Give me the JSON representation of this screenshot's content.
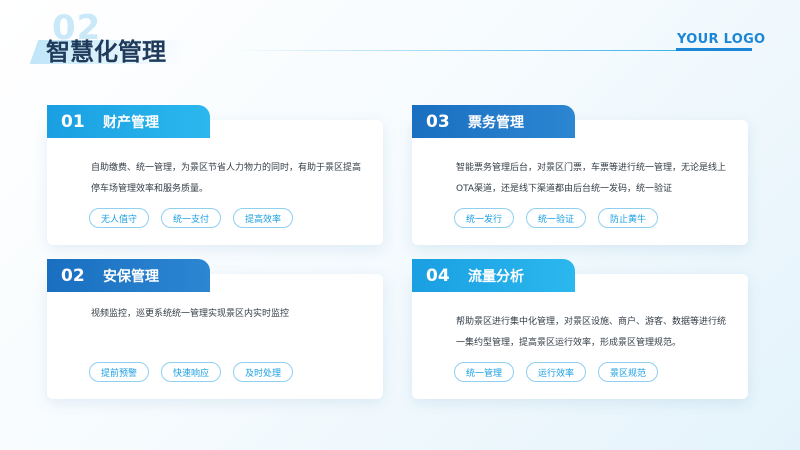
{
  "header": {
    "section_number": "02",
    "title": "智慧化管理",
    "logo": "YOUR LOGO"
  },
  "cards": [
    {
      "number": "01",
      "title": "财产管理",
      "description": "自助缴费、统一管理，为景区节省人力物力的同时，有助于景区提高停车场管理效率和服务质量。",
      "tags": [
        "无人值守",
        "统一支付",
        "提高效率"
      ]
    },
    {
      "number": "02",
      "title": "安保管理",
      "description": "视频监控，巡更系统统一管理实现景区内实时监控",
      "tags": [
        "提前预警",
        "快速响应",
        "及时处理"
      ]
    },
    {
      "number": "03",
      "title": "票务管理",
      "description": "智能票务管理后台，对景区门票，车票等进行统一管理，无论是线上OTA渠道，还是线下渠道都由后台统一发码，统一验证",
      "tags": [
        "统一发行",
        "统一验证",
        "防止黄牛"
      ]
    },
    {
      "number": "04",
      "title": "流量分析",
      "description": "帮助景区进行集中化管理，对景区设施、商户、游客、数据等进行统一集约型管理，提高景区运行效率，形成景区管理规范。",
      "tags": [
        "统一管理",
        "运行效率",
        "景区规范"
      ]
    }
  ],
  "colors": {
    "accent_light": "#1a9fe2",
    "accent_dark": "#1a6fc0",
    "title": "#1f3a5a",
    "logo": "#1b86d6"
  }
}
